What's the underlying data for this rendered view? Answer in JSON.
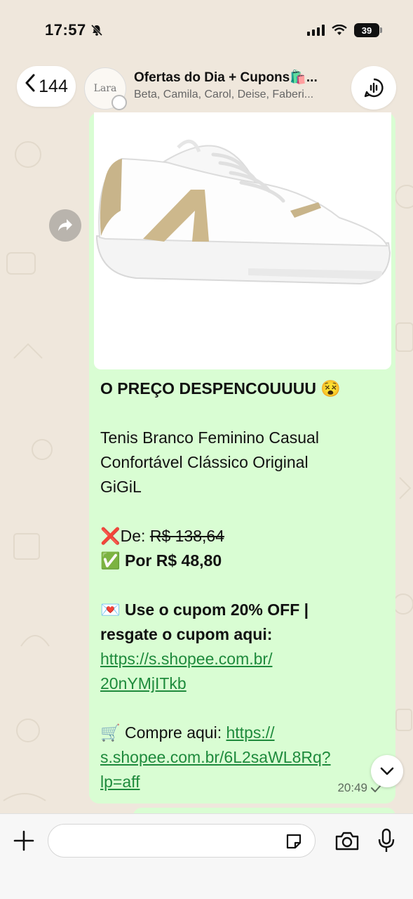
{
  "status_bar": {
    "time": "17:57",
    "battery": "39"
  },
  "header": {
    "back_count": "144",
    "avatar_text": "Lara",
    "chat_title": "Ofertas do Dia + Cupons🛍️...",
    "members": "Beta, Camila, Carol, Deise, Faberi..."
  },
  "message": {
    "headline": "O PREÇO DESPENCOUUUU 😵",
    "product_line1": "Tenis Branco Feminino Casual",
    "product_line2": "Confortável Clássico Original",
    "product_line3": "GiGiL",
    "old_price_prefix": "❌De: ",
    "old_price": "R$ 138,64",
    "new_price": "✅ Por R$ 48,80",
    "coupon_line1": "💌 Use o cupom 20% OFF |",
    "coupon_line2": "resgate o cupom aqui:",
    "coupon_link_line1": "https://s.shopee.com.br/",
    "coupon_link_line2": "20nYMjITkb",
    "buy_prefix": "🛒 Compre aqui: ",
    "buy_link_line1": "https://",
    "buy_link_line2": "s.shopee.com.br/6L2saWL8Rq?",
    "buy_link_line3": "lp=aff",
    "time": "20:49",
    "status_icon": "check-icon"
  },
  "input": {
    "value": "",
    "placeholder": ""
  },
  "colors": {
    "bubble": "#d9fdd3",
    "link": "#1e8a3c",
    "background": "#efe7dc"
  }
}
